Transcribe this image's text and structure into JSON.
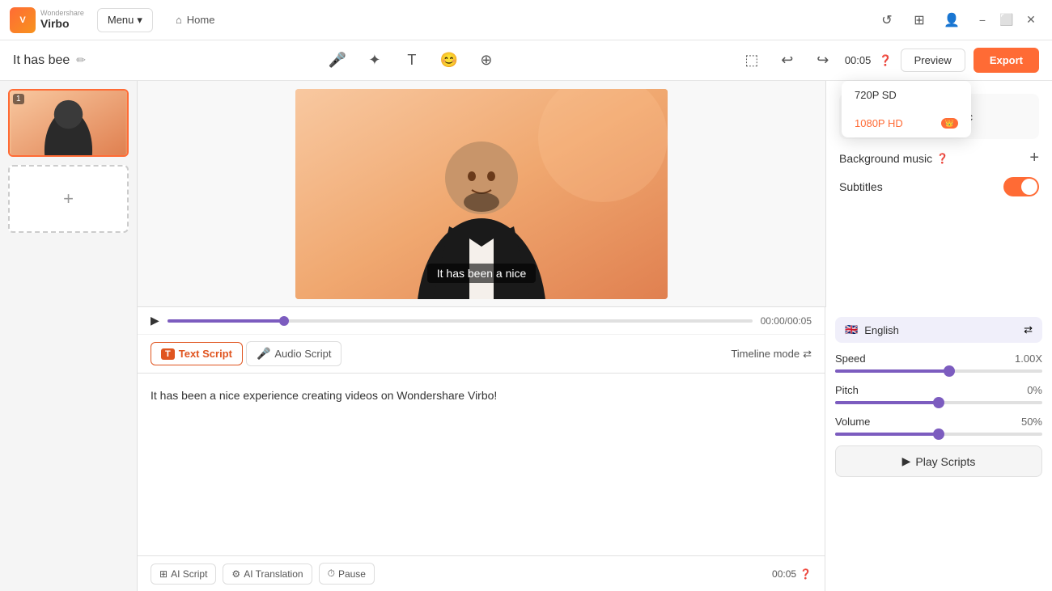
{
  "app": {
    "brand": "Wondershare",
    "name": "Virbo",
    "logo_text": "V"
  },
  "title_bar": {
    "menu_label": "Menu",
    "home_label": "Home",
    "icons": [
      "history",
      "grid",
      "person",
      "minimize",
      "maximize",
      "close"
    ]
  },
  "sub_header": {
    "project_title": "It has bee",
    "time_display": "00:05",
    "preview_label": "Preview",
    "export_label": "Export"
  },
  "dropdown": {
    "option_720": "720P SD",
    "option_1080": "1080P HD",
    "badge_label": "👑 HD"
  },
  "video": {
    "subtitle_text": "It has been a nice"
  },
  "right_panel": {
    "bg_music_label": "Background music",
    "subtitles_label": "Subtitles"
  },
  "playback": {
    "time_current": "00:00",
    "time_total": "00:05"
  },
  "script_tabs": {
    "text_script_label": "Text Script",
    "audio_script_label": "Audio Script",
    "timeline_mode_label": "Timeline mode"
  },
  "script_content": {
    "text": "It has been a nice experience creating videos on Wondershare Virbo!"
  },
  "bottom_bar": {
    "ai_script_label": "AI Script",
    "ai_translation_label": "AI Translation",
    "pause_label": "Pause",
    "duration_label": "00:05"
  },
  "voice_settings": {
    "language_label": "English",
    "speed_label": "Speed",
    "speed_value": "1.00X",
    "speed_percent": 55,
    "pitch_label": "Pitch",
    "pitch_value": "0%",
    "pitch_percent": 50,
    "volume_label": "Volume",
    "volume_value": "50%",
    "volume_percent": 50,
    "play_scripts_label": "Play Scripts"
  }
}
